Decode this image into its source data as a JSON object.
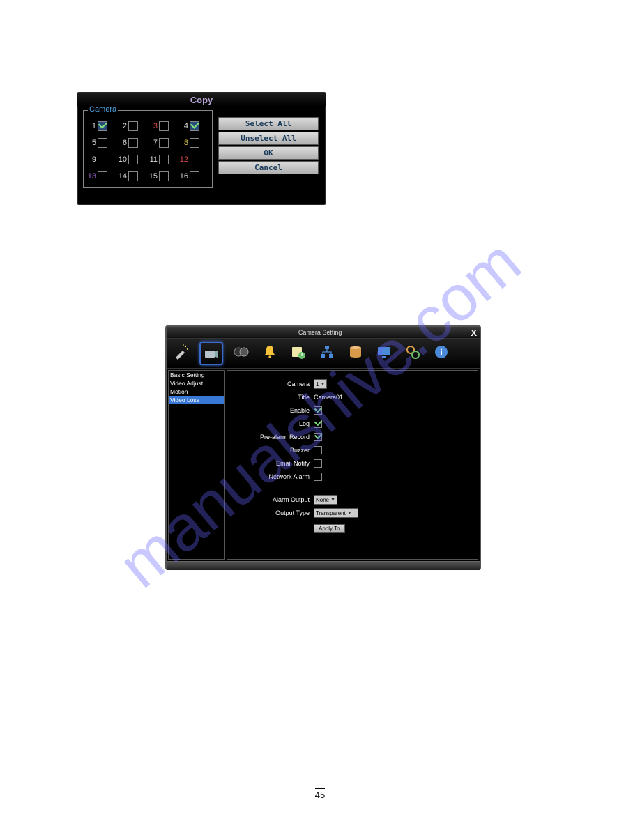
{
  "watermark": "manualshive.com",
  "page_number": "45",
  "copy_dialog": {
    "title": "Copy",
    "group_label": "Camera",
    "buttons": {
      "select_all": "Select All",
      "unselect_all": "Unselect All",
      "ok": "OK",
      "cancel": "Cancel"
    },
    "cameras": [
      {
        "n": "1",
        "checked": true,
        "cls": ""
      },
      {
        "n": "2",
        "checked": false,
        "cls": ""
      },
      {
        "n": "3",
        "checked": false,
        "cls": "red"
      },
      {
        "n": "4",
        "checked": true,
        "cls": ""
      },
      {
        "n": "5",
        "checked": false,
        "cls": ""
      },
      {
        "n": "6",
        "checked": false,
        "cls": ""
      },
      {
        "n": "7",
        "checked": false,
        "cls": ""
      },
      {
        "n": "8",
        "checked": false,
        "cls": "yellow"
      },
      {
        "n": "9",
        "checked": false,
        "cls": ""
      },
      {
        "n": "10",
        "checked": false,
        "cls": ""
      },
      {
        "n": "11",
        "checked": false,
        "cls": ""
      },
      {
        "n": "12",
        "checked": false,
        "cls": "red"
      },
      {
        "n": "13",
        "checked": false,
        "cls": "purple"
      },
      {
        "n": "14",
        "checked": false,
        "cls": ""
      },
      {
        "n": "15",
        "checked": false,
        "cls": ""
      },
      {
        "n": "16",
        "checked": false,
        "cls": ""
      }
    ]
  },
  "camera_setting": {
    "title": "Camera Setting",
    "side_items": [
      "Basic Setting",
      "Video Adjust",
      "Motion",
      "Video Loss"
    ],
    "side_selected": 3,
    "fields": {
      "camera_label": "Camera",
      "camera_value": "1",
      "title_label": "Title",
      "title_value": "Camera01",
      "enable_label": "Enable",
      "enable_checked": true,
      "log_label": "Log",
      "log_checked": true,
      "prealarm_label": "Pre-alarm Record",
      "prealarm_checked": true,
      "buzzer_label": "Buzzer",
      "buzzer_checked": false,
      "email_label": "Email Notify",
      "email_checked": false,
      "network_label": "Network Alarm",
      "network_checked": false,
      "alarm_output_label": "Alarm Output",
      "alarm_output_value": "None",
      "output_type_label": "Output Type",
      "output_type_value": "Transparent",
      "apply_label": "Apply To"
    }
  }
}
